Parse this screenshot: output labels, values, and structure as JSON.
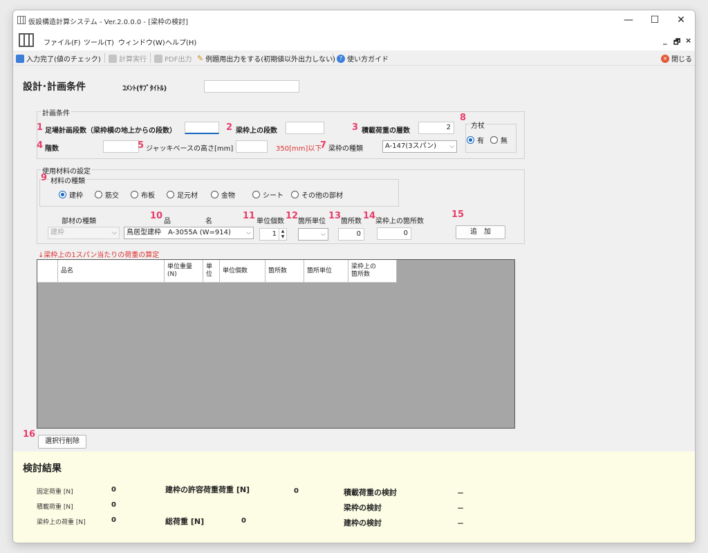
{
  "window": {
    "title": "仮設構造計算システム - Ver.2.0.0.0 - [梁枠の検討]",
    "controls": {
      "minimize": "—",
      "maximize": "☐",
      "close": "✕"
    }
  },
  "menu": {
    "items": [
      "ファイル(F)",
      "ツール(T)",
      "ウィンドウ(W)",
      "ヘルプ(H)"
    ],
    "mdi_minimize": "_",
    "mdi_restore": "🗗",
    "mdi_close": "×"
  },
  "toolbar": {
    "input_done": "入力完了(値のチェック)",
    "calc_run": "計算実行",
    "pdf_output": "PDF出力",
    "example_output": "例題用出力をする(初期値以外出力しない)",
    "guide": "使い方ガイド",
    "close": "閉じる"
  },
  "header": {
    "title": "設計･計画条件",
    "comment_label": "ｺﾒﾝﾄ(ｻﾌﾞﾀｲﾄﾙ)",
    "comment_value": ""
  },
  "plan": {
    "legend": "計画条件",
    "n1": "1",
    "scaffold_levels_label": "足場計画段数（梁枠横の地上からの段数）",
    "scaffold_levels_value": "",
    "n2": "2",
    "frame_levels_label": "梁枠上の段数",
    "frame_levels_value": "",
    "n3": "3",
    "load_layers_label": "積載荷重の層数",
    "load_layers_value": "2",
    "n4": "4",
    "floors_label": "階数",
    "floors_value": "",
    "n5": "5",
    "jack_label": "ジャッキベースの高さ[mm]",
    "jack_value": "",
    "jack_note": "350[mm]以下",
    "n7": "7",
    "frame_type_label": "梁枠の種類",
    "frame_type_value": "A-147(3スパン)",
    "n8": "8",
    "brace_label": "方杖",
    "brace_yes": "有",
    "brace_no": "無"
  },
  "materials": {
    "legend": "使用材料の設定",
    "n9": "9",
    "kind_legend": "材料の種類",
    "kinds": [
      "建枠",
      "筋交",
      "布板",
      "足元材",
      "金物",
      "シート",
      "その他の部材"
    ],
    "part_type_label": "部材の種類",
    "part_type_value": "建枠",
    "n10": "10",
    "name_label_1": "品",
    "name_label_2": "名",
    "name_value": "鳥居型建枠　A-3055A (W=914)",
    "n11": "11",
    "unit_count_label": "単位個数",
    "unit_count_value": "1",
    "n12": "12",
    "place_unit_label": "箇所単位",
    "place_unit_value": "",
    "n13": "13",
    "place_count_label": "箇所数",
    "place_count_value": "0",
    "n14": "14",
    "frame_place_label": "梁枠上の箇所数",
    "frame_place_value": "0",
    "n15": "15",
    "add_button": "追　加"
  },
  "table": {
    "caption": "↓梁枠上の1スパン当たりの荷重の算定",
    "columns": [
      "",
      "品名",
      "単位重量\n(N)",
      "単\n位",
      "単位個数",
      "箇所数",
      "箇所単位",
      "梁枠上の\n箇所数"
    ],
    "n16": "16",
    "delete_button": "選択行削除"
  },
  "results": {
    "title": "検討結果",
    "fixed_load_label": "固定荷重 [N]",
    "fixed_load_value": "0",
    "live_load_label": "積載荷重 [N]",
    "live_load_value": "0",
    "frame_load_label": "梁枠上の荷重 [N]",
    "frame_load_value": "0",
    "allowable_label": "建枠の許容荷重荷重 [N]",
    "allowable_value": "0",
    "total_label": "総荷重 [N]",
    "total_value": "0",
    "check1_label": "積載荷重の検討",
    "check1_value": "－",
    "check2_label": "梁枠の検討",
    "check2_value": "－",
    "check3_label": "建枠の検討",
    "check3_value": "－"
  }
}
